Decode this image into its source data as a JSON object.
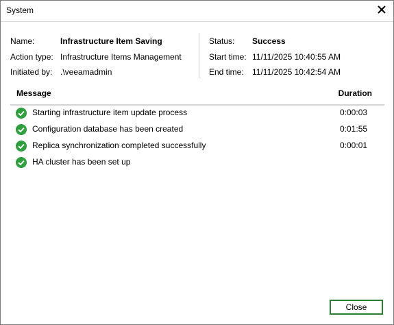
{
  "window": {
    "title": "System"
  },
  "info": {
    "name_label": "Name:",
    "name_value": "Infrastructure Item Saving",
    "action_label": "Action type:",
    "action_value": "Infrastructure Items Management",
    "initiated_label": "Initiated by:",
    "initiated_value": ".\\veeamadmin",
    "status_label": "Status:",
    "status_value": "Success",
    "start_label": "Start time:",
    "start_value": "11/11/2025 10:40:55 AM",
    "end_label": "End time:",
    "end_value": "11/11/2025 10:42:54 AM"
  },
  "grid": {
    "col_message": "Message",
    "col_duration": "Duration",
    "rows": [
      {
        "message": "Starting infrastructure item update process",
        "duration": "0:00:03",
        "icon": "success-check-icon"
      },
      {
        "message": "Configuration database has been created",
        "duration": "0:01:55",
        "icon": "success-check-icon"
      },
      {
        "message": "Replica synchronization completed successfully",
        "duration": "0:00:01",
        "icon": "success-check-icon"
      },
      {
        "message": "HA cluster has been set up",
        "duration": "",
        "icon": "success-check-icon"
      }
    ]
  },
  "buttons": {
    "close_label": "Close"
  },
  "colors": {
    "success_green": "#2e9e3f",
    "button_border": "#2e7d32"
  }
}
